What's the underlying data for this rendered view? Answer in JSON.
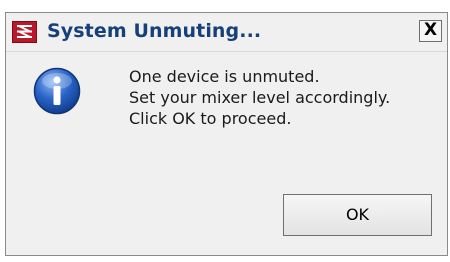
{
  "window": {
    "title": "System Unmuting...",
    "close_glyph": "X",
    "app_icon": "app-logo-icon"
  },
  "content": {
    "icon": "info-icon",
    "lines": [
      "One device is unmuted.",
      "Set your mixer level accordingly.",
      "Click OK to proceed."
    ]
  },
  "buttons": {
    "ok_label": "OK"
  },
  "colors": {
    "title_text": "#17407a",
    "dialog_bg": "#f0f0f0",
    "app_icon_bg": "#b8192b",
    "info_icon": "#2a64c8"
  }
}
